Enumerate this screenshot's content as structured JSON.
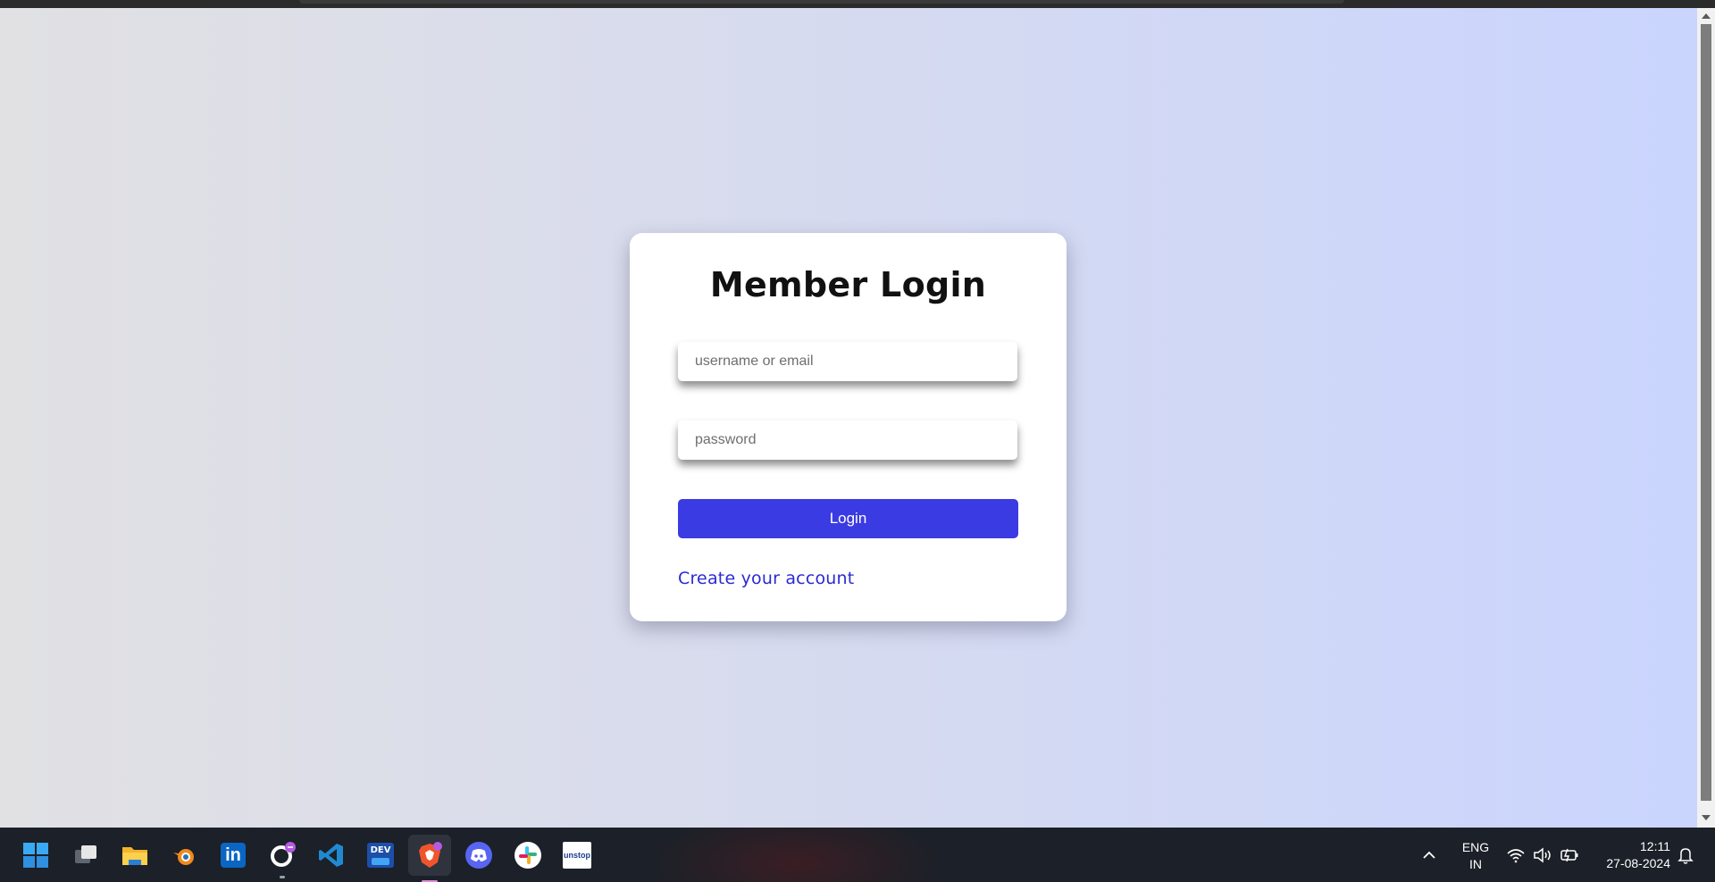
{
  "login": {
    "title": "Member Login",
    "username_placeholder": "username or email",
    "password_placeholder": "password",
    "login_label": "Login",
    "create_account_label": "Create your account",
    "accent_color": "#3b3be3",
    "link_color": "#2a2ad4"
  },
  "taskbar": {
    "apps": [
      {
        "name": "start",
        "icon": "windows-start-icon"
      },
      {
        "name": "task-view",
        "icon": "task-view-icon"
      },
      {
        "name": "file-explorer",
        "icon": "folder-icon"
      },
      {
        "name": "blender",
        "icon": "blender-icon"
      },
      {
        "name": "linkedin",
        "icon": "linkedin-icon",
        "label": "in"
      },
      {
        "name": "github",
        "icon": "github-icon"
      },
      {
        "name": "vscode",
        "icon": "vscode-icon"
      },
      {
        "name": "devhome",
        "icon": "dev-home-icon",
        "label": "DEV"
      },
      {
        "name": "brave",
        "icon": "brave-browser-icon"
      },
      {
        "name": "discord",
        "icon": "discord-icon"
      },
      {
        "name": "slack",
        "icon": "slack-icon"
      },
      {
        "name": "unstop",
        "icon": "unstop-icon",
        "label": "unstop"
      }
    ],
    "tray": {
      "overflow_icon": "chevron-up-icon",
      "language_line1": "ENG",
      "language_line2": "IN",
      "wifi_icon": "wifi-icon",
      "volume_icon": "volume-icon",
      "battery_icon": "battery-charging-icon",
      "time": "12:11",
      "date": "27-08-2024",
      "notification_icon": "bell-icon"
    }
  }
}
